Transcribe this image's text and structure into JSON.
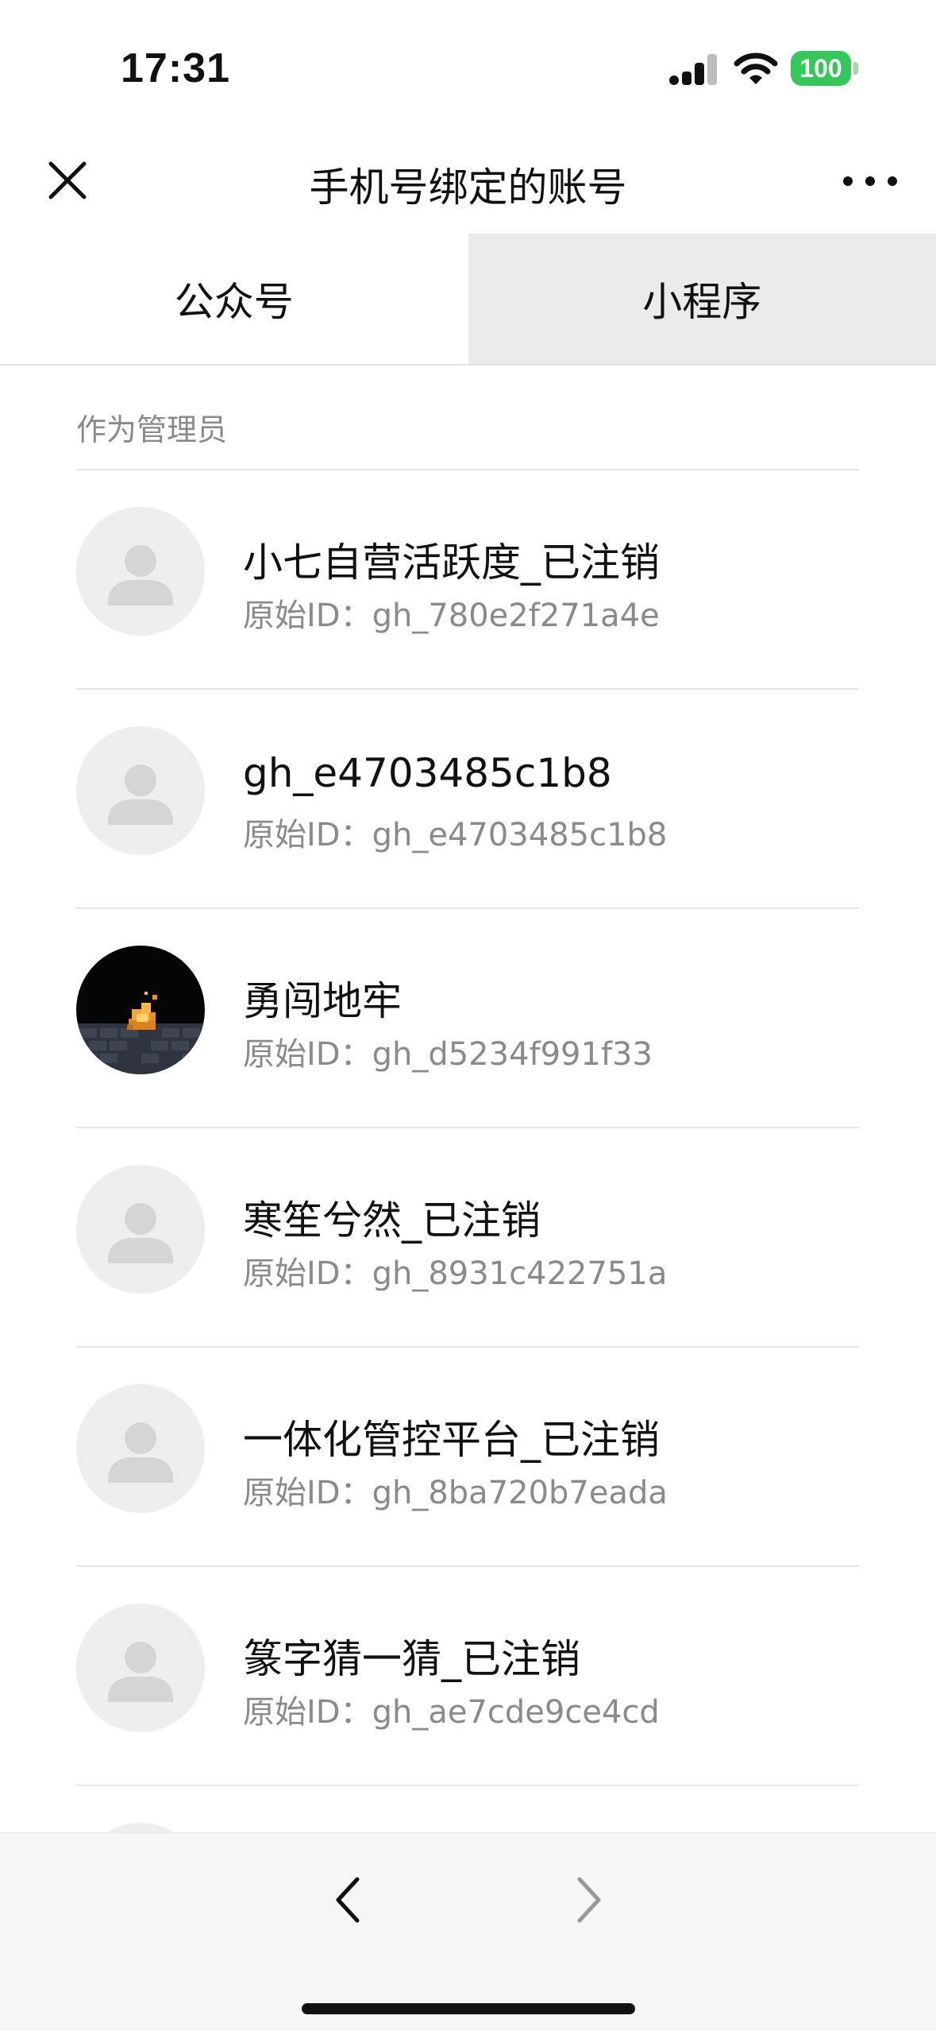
{
  "status_bar": {
    "time": "17:31",
    "battery_level": "100",
    "battery_color": "#34c759"
  },
  "nav": {
    "title": "手机号绑定的账号",
    "close_icon": "close-icon",
    "more_icon": "more-dots-icon"
  },
  "tabs": [
    {
      "label": "公众号",
      "active": false
    },
    {
      "label": "小程序",
      "active": true
    }
  ],
  "section": {
    "label": "作为管理员"
  },
  "accounts": [
    {
      "name": "小七自营活跃度_已注销",
      "id": "原始ID：gh_780e2f271a4e",
      "avatar": "default-avatar"
    },
    {
      "name": "gh_e4703485c1b8",
      "id": "原始ID：gh_e4703485c1b8",
      "avatar": "default-avatar"
    },
    {
      "name": "勇闯地牢",
      "id": "原始ID：gh_d5234f991f33",
      "avatar": "dungeon-fire-avatar"
    },
    {
      "name": "寒笙兮然_已注销",
      "id": "原始ID：gh_8931c422751a",
      "avatar": "default-avatar"
    },
    {
      "name": "一体化管控平台_已注销",
      "id": "原始ID：gh_8ba720b7eada",
      "avatar": "default-avatar"
    },
    {
      "name": "篆字猜一猜_已注销",
      "id": "原始ID：gh_ae7cde9ce4cd",
      "avatar": "default-avatar"
    }
  ],
  "toolbar": {
    "back_icon": "chevron-left-icon",
    "forward_icon": "chevron-right-icon"
  }
}
